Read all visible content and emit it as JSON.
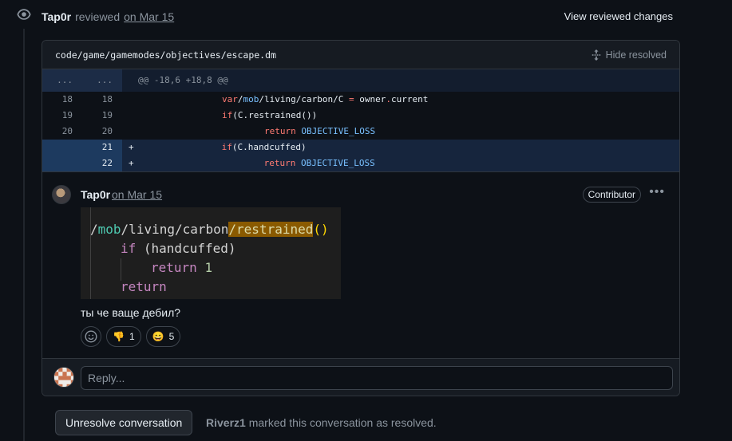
{
  "review": {
    "author": "Tap0r",
    "action": "reviewed",
    "date": "on Mar 15",
    "view_changes": "View reviewed changes"
  },
  "file": {
    "path": "code/game/gamemodes/objectives/escape.dm",
    "hide_resolved": "Hide resolved"
  },
  "diff": {
    "hunk_left": "...",
    "hunk_right": "...",
    "hunk_header": "@@ -18,6 +18,8 @@",
    "lines": [
      {
        "old": "18",
        "new": "18",
        "sign": "",
        "text": "var/mob/living/carbon/C = owner.current",
        "type": "context"
      },
      {
        "old": "19",
        "new": "19",
        "sign": "",
        "text": "if(C.restrained())",
        "type": "context"
      },
      {
        "old": "20",
        "new": "20",
        "sign": "",
        "text": "return OBJECTIVE_LOSS",
        "type": "context"
      },
      {
        "old": "",
        "new": "21",
        "sign": "+",
        "text": "if(C.handcuffed)",
        "type": "add"
      },
      {
        "old": "",
        "new": "22",
        "sign": "+",
        "text": "return OBJECTIVE_LOSS",
        "type": "add"
      }
    ]
  },
  "comment": {
    "author": "Tap0r",
    "date": "on Mar 15",
    "badge": "Contributor",
    "body": "ты че ваще дебил?",
    "code_image": {
      "line1_a": "/",
      "line1_b": "mob",
      "line1_c": "/living/carbon",
      "line1_d": "/restrained",
      "line1_e": "()",
      "line2_kw": "if",
      "line2_rest": " (handcuffed)",
      "line3_kw": "return",
      "line3_num": "1",
      "line4_kw": "return"
    },
    "reactions": [
      {
        "icon": "thumbs-down-icon",
        "glyph": "👎",
        "count": "1"
      },
      {
        "icon": "smile-icon",
        "glyph": "😄",
        "count": "5"
      }
    ]
  },
  "reply": {
    "placeholder": "Reply..."
  },
  "resolution": {
    "button": "Unresolve conversation",
    "who": "Riverz1",
    "text": " marked this conversation as resolved."
  },
  "colors": {
    "background": "#0d1117",
    "border": "#30363d",
    "addition_bg": "#16253d",
    "hunk_bg": "#131d2e"
  }
}
